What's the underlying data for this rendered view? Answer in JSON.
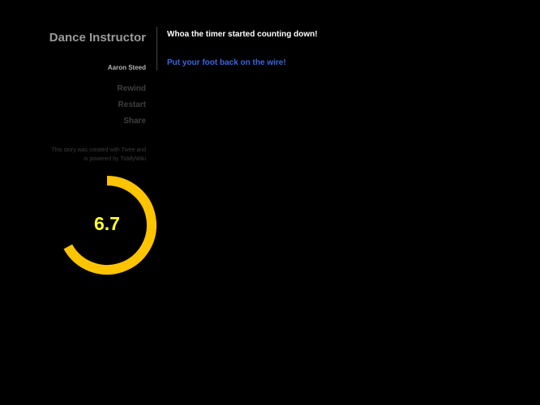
{
  "sidebar": {
    "title": "Dance Instructor",
    "author": "Aaron Steed",
    "menu": [
      {
        "label": "Rewind"
      },
      {
        "label": "Restart"
      },
      {
        "label": "Share"
      }
    ],
    "credits": "This story was created with Twee and is powered by TiddlyWiki"
  },
  "passage": {
    "text": "Whoa the timer started counting down!",
    "link": "Put your foot back on the wire!"
  },
  "timer": {
    "value": "6.7",
    "ring_color": "#ffc400",
    "text_color": "#ffff33",
    "fraction_remaining": 0.67
  },
  "colors": {
    "background": "#000000",
    "link": "#3a66e0"
  }
}
